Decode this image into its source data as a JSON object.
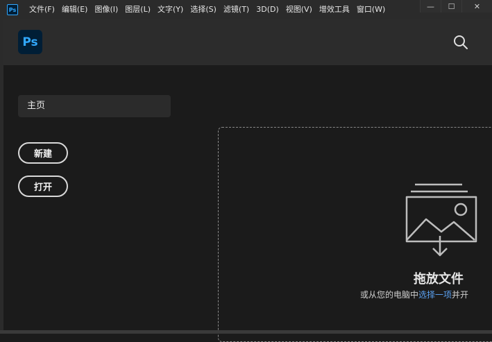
{
  "menubar": {
    "app_icon": "Ps",
    "items": [
      "文件(F)",
      "编辑(E)",
      "图像(I)",
      "图层(L)",
      "文字(Y)",
      "选择(S)",
      "滤镜(T)",
      "3D(D)",
      "视图(V)",
      "增效工具",
      "窗口(W)"
    ],
    "window_controls": {
      "minimize": "—",
      "maximize": "☐",
      "close": "✕"
    }
  },
  "header": {
    "logo": "Ps",
    "search_icon": "search-icon"
  },
  "sidebar": {
    "home_label": "主页",
    "new_label": "新建",
    "open_label": "打开"
  },
  "dropzone": {
    "title": "拖放文件",
    "subtitle_prefix": "或从您的电脑中",
    "subtitle_link": "选择一项",
    "subtitle_suffix": "并开"
  },
  "colors": {
    "background": "#1b1b1b",
    "header": "#2c2c2c",
    "accent_blue": "#31a8ff",
    "link": "#5aa0f0"
  }
}
